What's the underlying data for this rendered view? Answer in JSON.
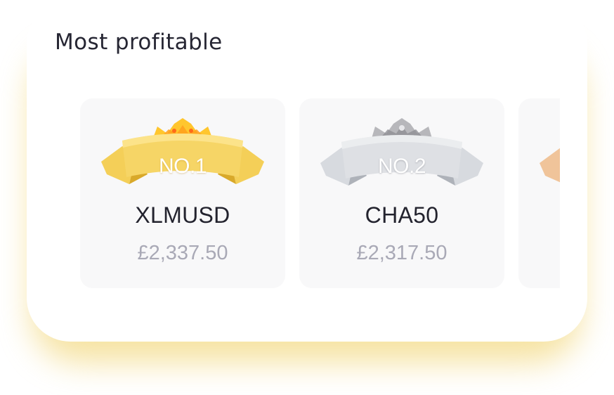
{
  "widget": {
    "title": "Most profitable"
  },
  "ranking": [
    {
      "badge": "NO.1",
      "symbol": "XLMUSD",
      "profit": "£2,337.50",
      "tier_color": "#f2c94c"
    },
    {
      "badge": "NO.2",
      "symbol": "CHA50",
      "profit": "£2,317.50",
      "tier_color": "#d6d9de"
    },
    {
      "tier_color": "#f0c49a"
    }
  ],
  "icons": {
    "gold": "crown-ribbon-gold-icon",
    "silver": "crown-ribbon-silver-icon",
    "bronze": "ribbon-bronze-icon"
  },
  "colors": {
    "glow": "#eecc56",
    "title": "#262633",
    "symbol": "#23232e",
    "profit": "#a9a9b6",
    "card_bg": "#f8f8f9"
  }
}
